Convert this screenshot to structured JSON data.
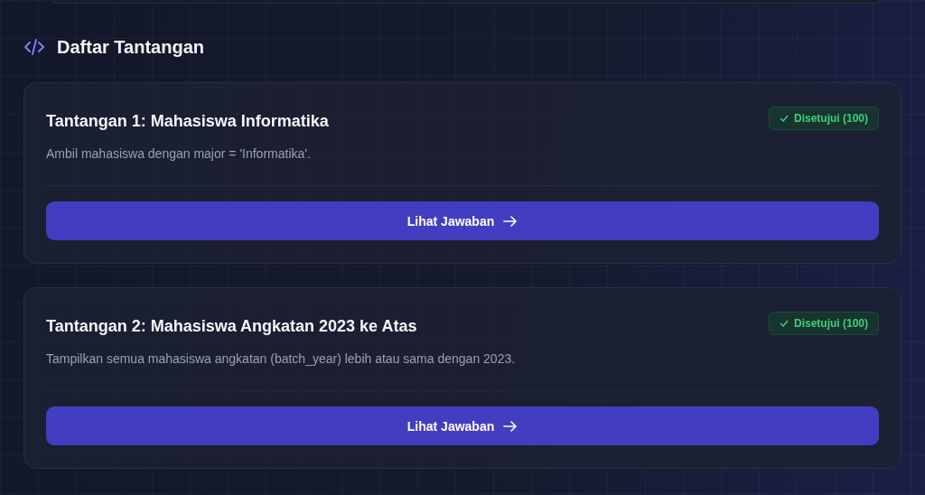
{
  "section": {
    "title": "Daftar Tantangan"
  },
  "challenges": [
    {
      "title": "Tantangan 1: Mahasiswa Informatika",
      "approved": true,
      "badge": "Disetujui (100)",
      "description": "Ambil mahasiswa dengan major = 'Informatika'.",
      "button": "Lihat Jawaban"
    },
    {
      "title": "Tantangan 2: Mahasiswa Angkatan 2023 ke Atas",
      "approved": true,
      "badge": "Disetujui (100)",
      "description": "Tampilkan semua mahasiswa angkatan (batch_year) lebih atau sama dengan 2023.",
      "button": "Lihat Jawaban"
    }
  ]
}
